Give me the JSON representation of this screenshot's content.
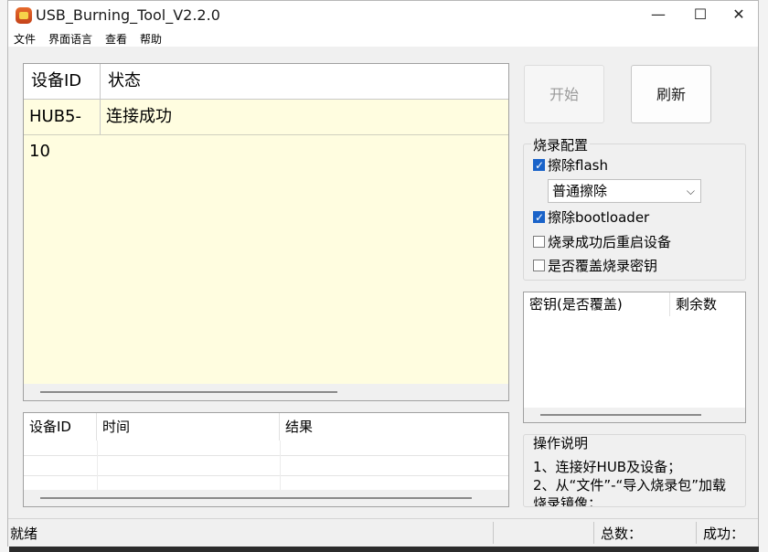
{
  "window": {
    "title": "USB_Burning_Tool_V2.2.0",
    "controls": {
      "minimize": "—",
      "maximize": "☐",
      "close": "✕"
    }
  },
  "menu": [
    "文件",
    "界面语言",
    "查看",
    "帮助"
  ],
  "device_table": {
    "columns": [
      "设备ID",
      "状态"
    ],
    "rows": [
      {
        "id": "HUB5-10",
        "status": "连接成功"
      }
    ],
    "background": "#fffde0"
  },
  "result_table": {
    "columns": [
      "设备ID",
      "时间",
      "结果"
    ]
  },
  "buttons": {
    "start": "开始",
    "refresh": "刷新"
  },
  "config": {
    "title": "烧录配置",
    "erase_flash": {
      "label": "擦除flash",
      "checked": true
    },
    "erase_mode": {
      "selected": "普通擦除"
    },
    "erase_bootloader": {
      "label": "擦除bootloader",
      "checked": true
    },
    "reboot_after": {
      "label": "烧录成功后重启设备",
      "checked": false
    },
    "overwrite_key": {
      "label": "是否覆盖烧录密钥",
      "checked": false
    }
  },
  "key_table": {
    "columns": [
      "密钥(是否覆盖)",
      "剩余数"
    ]
  },
  "instructions": {
    "title": "操作说明",
    "lines": [
      "1、连接好HUB及设备；",
      "2、从“文件”-“导入烧录包”加载",
      "烧录镜像；"
    ]
  },
  "statusbar": {
    "status": "就绪",
    "total_label": "总数：",
    "success_label": "成功："
  },
  "colors": {
    "accent": "#1a63c9"
  }
}
